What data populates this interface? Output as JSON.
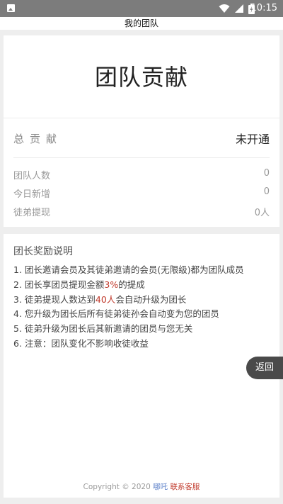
{
  "status_bar": {
    "time": "10:15",
    "icons": [
      "gallery-icon",
      "wifi-icon",
      "signal-icon",
      "battery-icon"
    ]
  },
  "header": {
    "title": "我的团队"
  },
  "contribution": {
    "title": "团队贡献",
    "total_label": "总贡献",
    "total_value": "未开通",
    "stats": [
      {
        "label": "团队人数",
        "value": "0"
      },
      {
        "label": "今日新增",
        "value": "0"
      },
      {
        "label": "徒弟提现",
        "value": "0人"
      }
    ]
  },
  "rules": {
    "title": "团长奖励说明",
    "items": [
      {
        "before": "1. 团长邀请会员及其徒弟邀请的会员(无限级)都为团队成员",
        "highlight": "",
        "after": ""
      },
      {
        "before": "2. 团长享团员提现金额",
        "highlight": "3%",
        "after": "的提成"
      },
      {
        "before": "3. 徒弟提现人数达到",
        "highlight": "40人",
        "after": "会自动升级为团长"
      },
      {
        "before": "4. 您升级为团长后所有徒弟徒孙会自动变为您的团员",
        "highlight": "",
        "after": ""
      },
      {
        "before": "5. 徒弟升级为团长后其新邀请的团员与您无关",
        "highlight": "",
        "after": ""
      },
      {
        "before": "6. 注意：团队变化不影响收徒收益",
        "highlight": "",
        "after": ""
      }
    ]
  },
  "back_button": {
    "label": "返回"
  },
  "footer": {
    "copyright": "Copyright © 2020",
    "brand": "哪吒",
    "service_link": "联系客服"
  },
  "colors": {
    "highlight": "#c0392b",
    "brand": "#5a7fc8",
    "status_bar": "#7c7c7c"
  }
}
